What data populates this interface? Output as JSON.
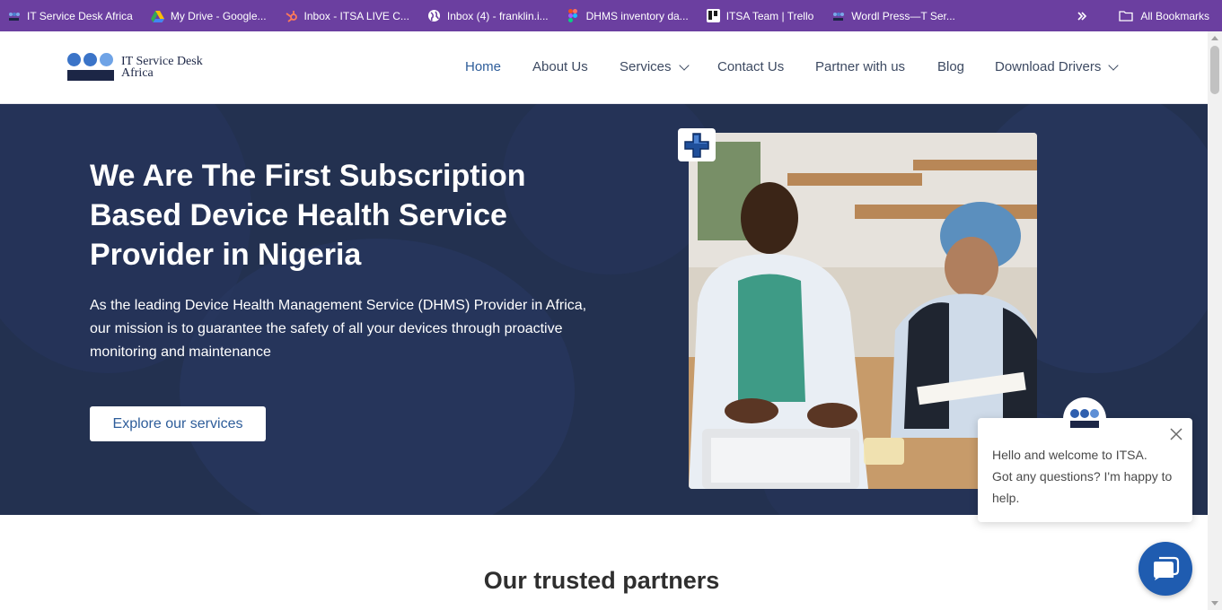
{
  "bookmarks_bar": {
    "items": [
      {
        "label": "IT Service Desk Africa",
        "icon": "itsa-logo-icon"
      },
      {
        "label": "My Drive - Google...",
        "icon": "google-drive-icon"
      },
      {
        "label": "Inbox - ITSA LIVE C...",
        "icon": "hubspot-icon"
      },
      {
        "label": "Inbox (4) - franklin.i...",
        "icon": "globe-icon"
      },
      {
        "label": "DHMS inventory da...",
        "icon": "figma-icon"
      },
      {
        "label": "ITSA Team | Trello",
        "icon": "trello-icon"
      },
      {
        "label": "Wordl Press—T Ser...",
        "icon": "itsa-logo-icon"
      }
    ],
    "overflow_icon": "double-chevron-icon",
    "all_bookmarks": "All Bookmarks"
  },
  "header": {
    "logo_text": "IT Service Desk Africa",
    "logo_line1": "IT Service Desk",
    "logo_line2": "Africa",
    "nav": [
      {
        "label": "Home",
        "active": true
      },
      {
        "label": "About Us"
      },
      {
        "label": "Services",
        "dropdown": true
      },
      {
        "label": "Contact Us"
      },
      {
        "label": "Partner with us"
      },
      {
        "label": "Blog"
      },
      {
        "label": "Download Drivers",
        "dropdown": true
      }
    ]
  },
  "hero": {
    "title_line1": "We Are The First Subscription",
    "title_line2": "Based Device Health Service",
    "title_line3": "Provider in Nigeria",
    "description": "As the leading Device Health Management Service (DHMS) Provider in Africa, our mission is to guarantee the safety of all your devices through proactive monitoring and maintenance",
    "cta_label": "Explore our services",
    "badge_icon": "medical-plus-icon"
  },
  "partners": {
    "title": "Our trusted partners"
  },
  "chat": {
    "line1": "Hello and welcome to ITSA.",
    "line2": "Got any questions? I'm happy to help.",
    "close_icon": "close-icon",
    "launcher_icon": "chat-bubble-icon"
  },
  "colors": {
    "bookmarks_bg": "#6b3fa0",
    "hero_bg": "#233150",
    "brand_blue": "#2e5d9a",
    "chat_button": "#1f5cb0"
  }
}
